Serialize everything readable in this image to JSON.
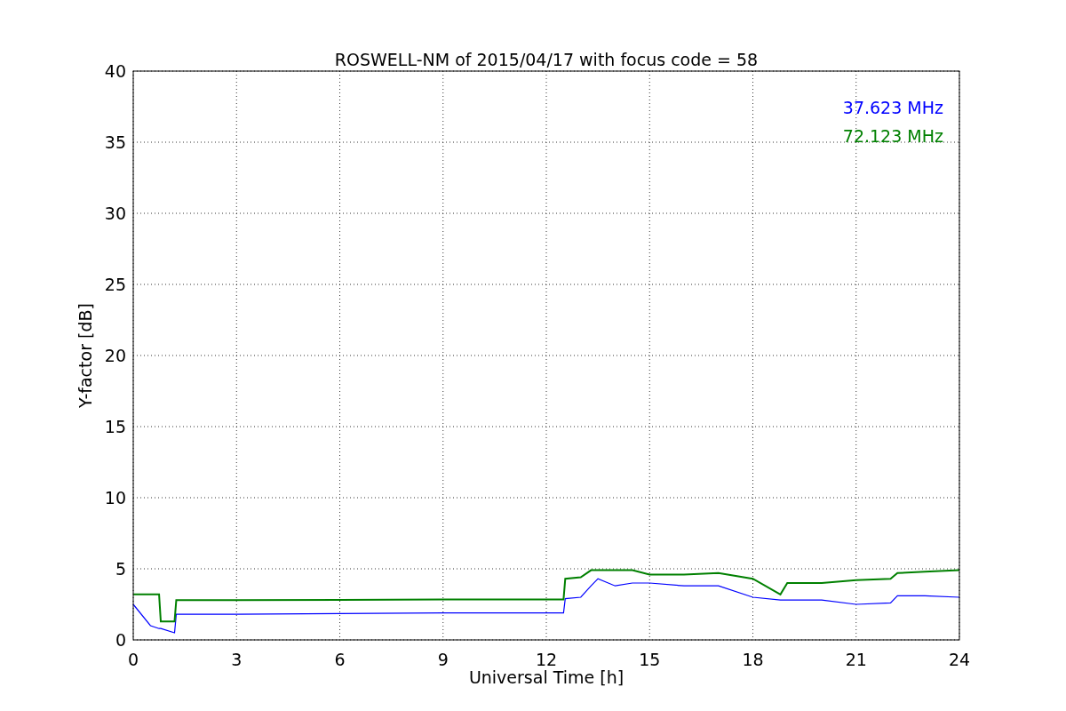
{
  "chart_data": {
    "type": "line",
    "title": "ROSWELL-NM of 2015/04/17 with focus code = 58",
    "xlabel": "Universal Time [h]",
    "ylabel": "Y-factor [dB]",
    "x": [
      0,
      0.5,
      0.75,
      0.8,
      1.2,
      1.25,
      3,
      6,
      9,
      12.5,
      12.55,
      13,
      13.3,
      13.5,
      14,
      14.5,
      15,
      16,
      17,
      18,
      18.8,
      19,
      20,
      21,
      22,
      22.2,
      23,
      24
    ],
    "series": [
      {
        "name": "37.623 MHz",
        "color": "#0000ff",
        "values": [
          2.5,
          1.0,
          0.8,
          0.8,
          0.5,
          1.8,
          1.8,
          1.85,
          1.9,
          1.9,
          2.9,
          3.0,
          3.8,
          4.3,
          3.8,
          4.0,
          4.0,
          3.8,
          3.8,
          3.0,
          2.8,
          2.8,
          2.8,
          2.5,
          2.6,
          3.1,
          3.1,
          3.0
        ]
      },
      {
        "name": "72.123 MHz",
        "color": "#008000",
        "values": [
          3.2,
          3.2,
          3.2,
          1.3,
          1.3,
          2.8,
          2.8,
          2.82,
          2.85,
          2.85,
          4.3,
          4.4,
          4.9,
          4.9,
          4.9,
          4.9,
          4.6,
          4.6,
          4.7,
          4.3,
          3.2,
          4.0,
          4.0,
          4.2,
          4.3,
          4.7,
          4.8,
          4.9
        ]
      }
    ],
    "grid": true,
    "xlim": [
      0,
      24
    ],
    "ylim": [
      0,
      40
    ],
    "xticks": [
      0,
      3,
      6,
      9,
      12,
      15,
      18,
      21,
      24
    ],
    "yticks": [
      0,
      5,
      10,
      15,
      20,
      25,
      30,
      35,
      40
    ]
  }
}
